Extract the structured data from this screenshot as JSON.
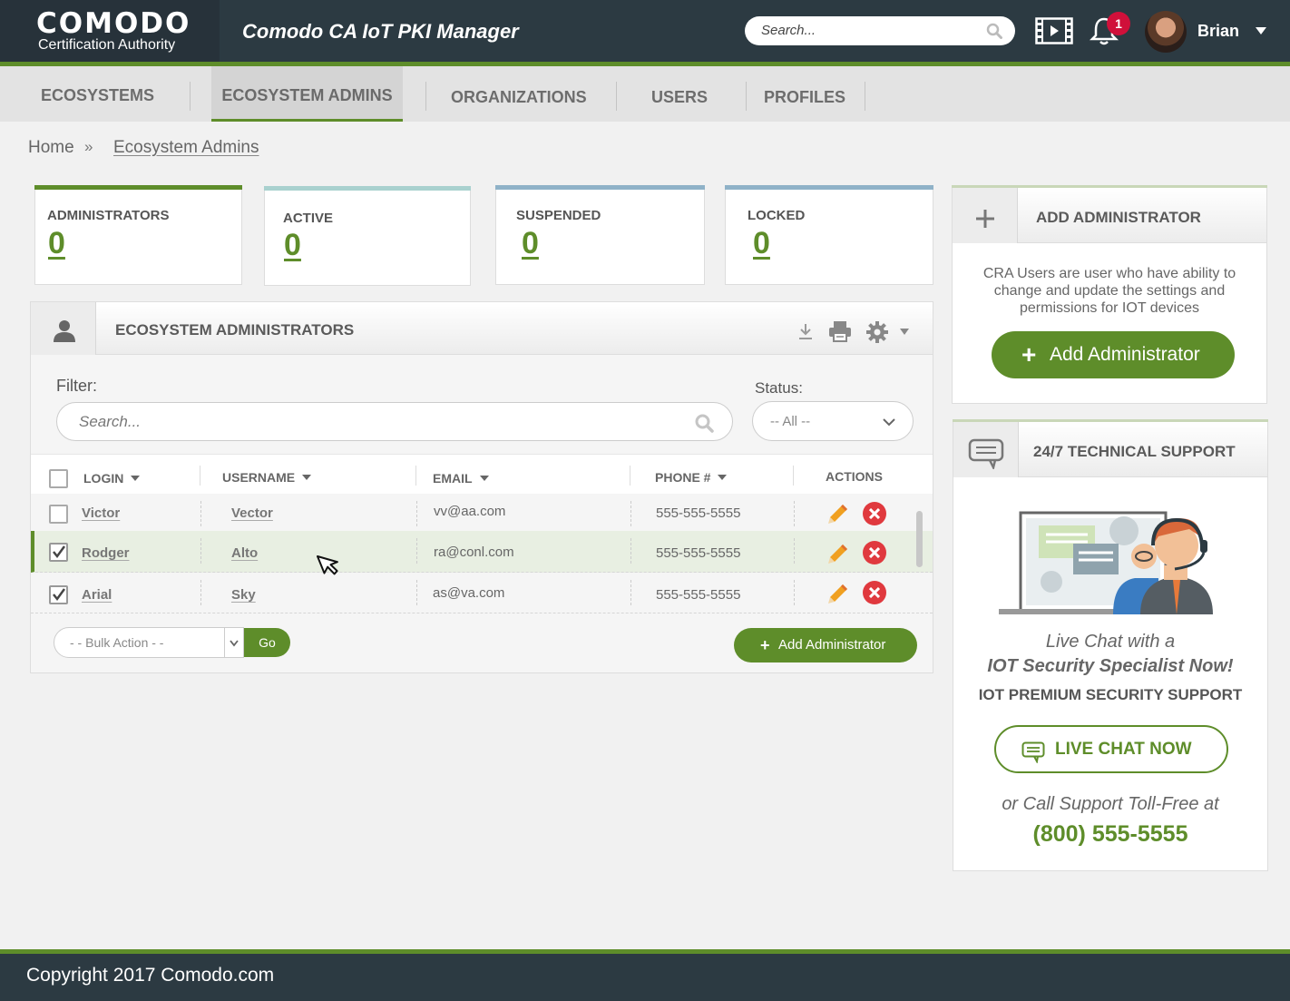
{
  "header": {
    "logo_main": "COMODO",
    "logo_sub": "Certification Authority",
    "app_title": "Comodo CA IoT PKI Manager",
    "search_placeholder": "Search...",
    "notification_count": "1",
    "user_name": "Brian"
  },
  "nav": {
    "items": [
      {
        "label": "ECOSYSTEMS"
      },
      {
        "label": "ECOSYSTEM ADMINS",
        "active": true
      },
      {
        "label": "ORGANIZATIONS"
      },
      {
        "label": "USERS"
      },
      {
        "label": "PROFILES"
      }
    ]
  },
  "breadcrumb": {
    "home": "Home",
    "separator": "»",
    "current": "Ecosystem Admins"
  },
  "stats": [
    {
      "label": "ADMINISTRATORS",
      "value": "0",
      "color": "#5e8d2a"
    },
    {
      "label": "ACTIVE",
      "value": "0",
      "color": "#a9d1cf"
    },
    {
      "label": "SUSPENDED",
      "value": "0",
      "color": "#8fb2c8"
    },
    {
      "label": "LOCKED",
      "value": "0",
      "color": "#8fb2c8"
    }
  ],
  "panel": {
    "title": "ECOSYSTEM ADMINISTRATORS",
    "filter_label": "Filter:",
    "filter_placeholder": "Search...",
    "status_label": "Status:",
    "status_value": "-- All --",
    "columns": {
      "login": "LOGIN",
      "username": "USERNAME",
      "email": "EMAIL",
      "phone": "PHONE #",
      "actions": "ACTIONS"
    },
    "rows": [
      {
        "login": "Victor",
        "username": "Vector",
        "email": "vv@aa.com",
        "phone": "555-555-5555",
        "checked": false
      },
      {
        "login": "Rodger",
        "username": "Alto",
        "email": "ra@conl.com",
        "phone": "555-555-5555",
        "checked": true
      },
      {
        "login": "Arial",
        "username": "Sky",
        "email": "as@va.com",
        "phone": "555-555-5555",
        "checked": true
      }
    ],
    "bulk_action": "- - Bulk Action - -",
    "go_label": "Go",
    "add_label": "Add Administrator"
  },
  "add_admin": {
    "title": "ADD ADMINISTRATOR",
    "description": "CRA Users are user who have ability to change and update the settings and permissions for IOT devices",
    "button": "Add Administrator"
  },
  "support": {
    "title": "24/7 TECHNICAL SUPPORT",
    "chat_line1": "Live Chat with a",
    "chat_line2": "IOT Security Specialist Now!",
    "premium": "IOT PREMIUM SECURITY SUPPORT",
    "live_chat_button": "LIVE CHAT NOW",
    "call_line": "or Call Support Toll-Free at",
    "phone": "(800) 555-5555"
  },
  "footer": {
    "copyright": "Copyright 2017 Comodo.com"
  },
  "colors": {
    "brand_green": "#5e8d2a",
    "header_bg": "#2c3a42",
    "danger": "#e0393e"
  }
}
